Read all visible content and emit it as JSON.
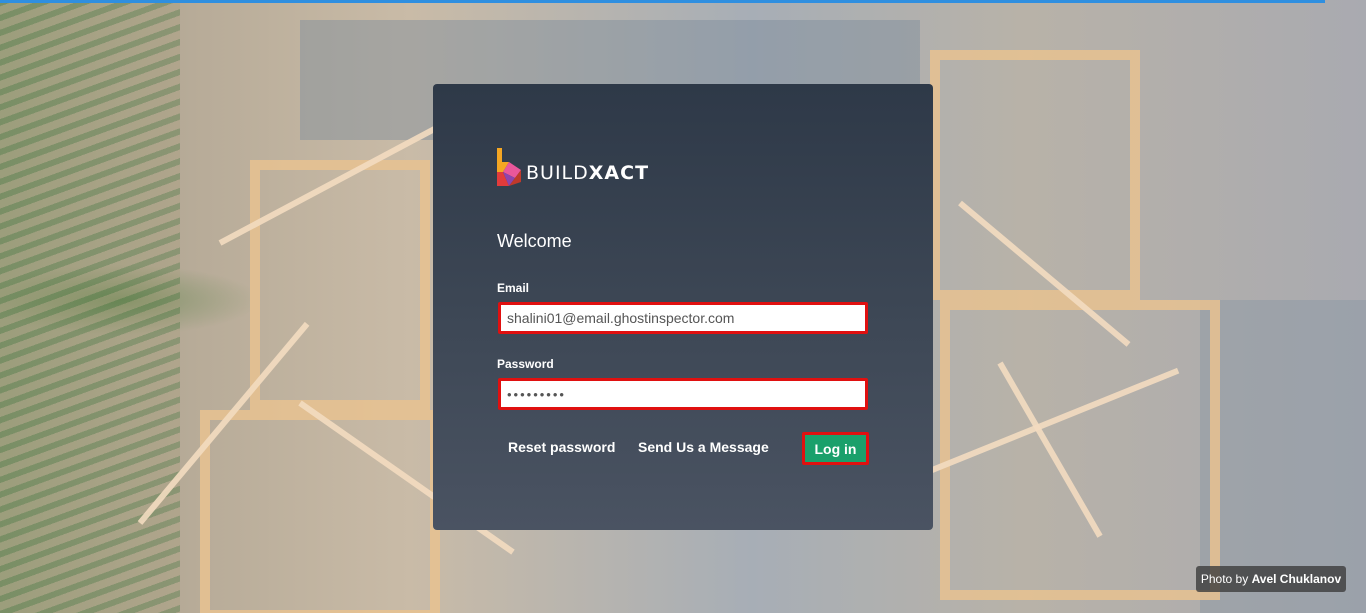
{
  "brand": {
    "name_light": "BUILD",
    "name_bold": "XACT",
    "colors": {
      "mark_orange": "#f4a623",
      "mark_red": "#e23b3b",
      "mark_purple": "#8e44ad",
      "mark_pink": "#e9579b"
    }
  },
  "login": {
    "heading": "Welcome",
    "email_label": "Email",
    "email_value": "shalini01@email.ghostinspector.com",
    "password_label": "Password",
    "password_value": "•••••••••",
    "reset_link": "Reset password",
    "message_link": "Send Us a Message",
    "submit_label": "Log in"
  },
  "photo_credit": {
    "prefix": "Photo by ",
    "author": "Avel Chuklanov"
  },
  "colors": {
    "accent_green": "#1aa06b",
    "highlight_red": "#e01010",
    "top_bar_blue": "#2f8fe0"
  }
}
